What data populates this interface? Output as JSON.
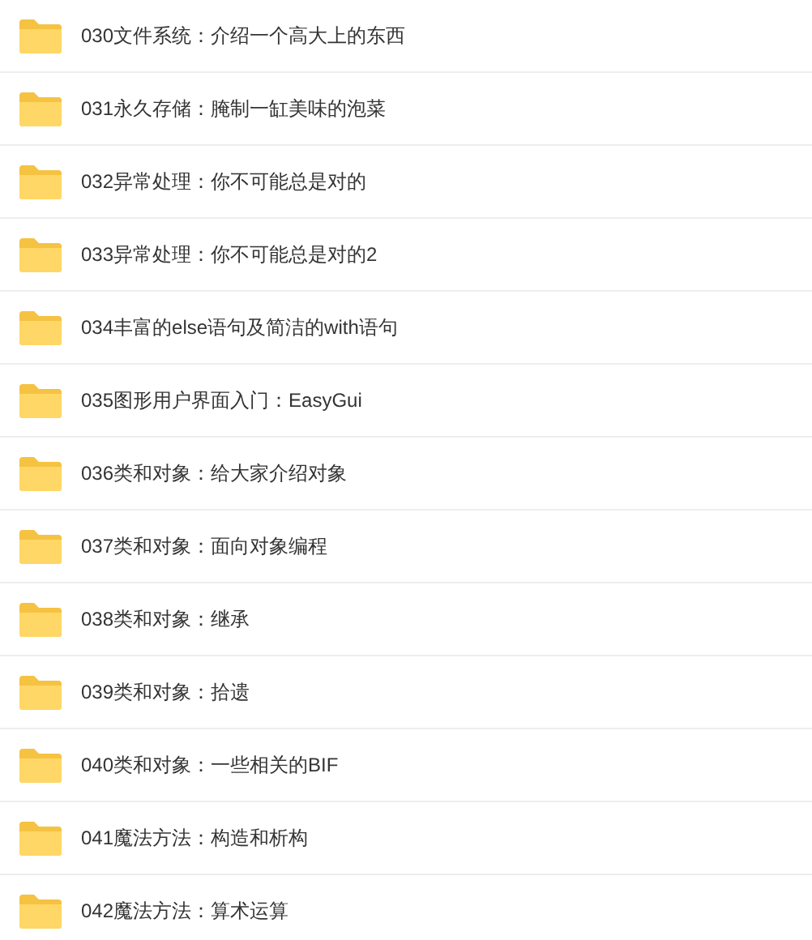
{
  "files": [
    {
      "name": "030文件系统：介绍一个高大上的东西"
    },
    {
      "name": "031永久存储：腌制一缸美味的泡菜"
    },
    {
      "name": "032异常处理：你不可能总是对的"
    },
    {
      "name": "033异常处理：你不可能总是对的2"
    },
    {
      "name": "034丰富的else语句及简洁的with语句"
    },
    {
      "name": "035图形用户界面入门：EasyGui"
    },
    {
      "name": "036类和对象：给大家介绍对象"
    },
    {
      "name": "037类和对象：面向对象编程"
    },
    {
      "name": "038类和对象：继承"
    },
    {
      "name": "039类和对象：拾遗"
    },
    {
      "name": "040类和对象：一些相关的BIF"
    },
    {
      "name": "041魔法方法：构造和析构"
    },
    {
      "name": "042魔法方法：算术运算"
    }
  ]
}
